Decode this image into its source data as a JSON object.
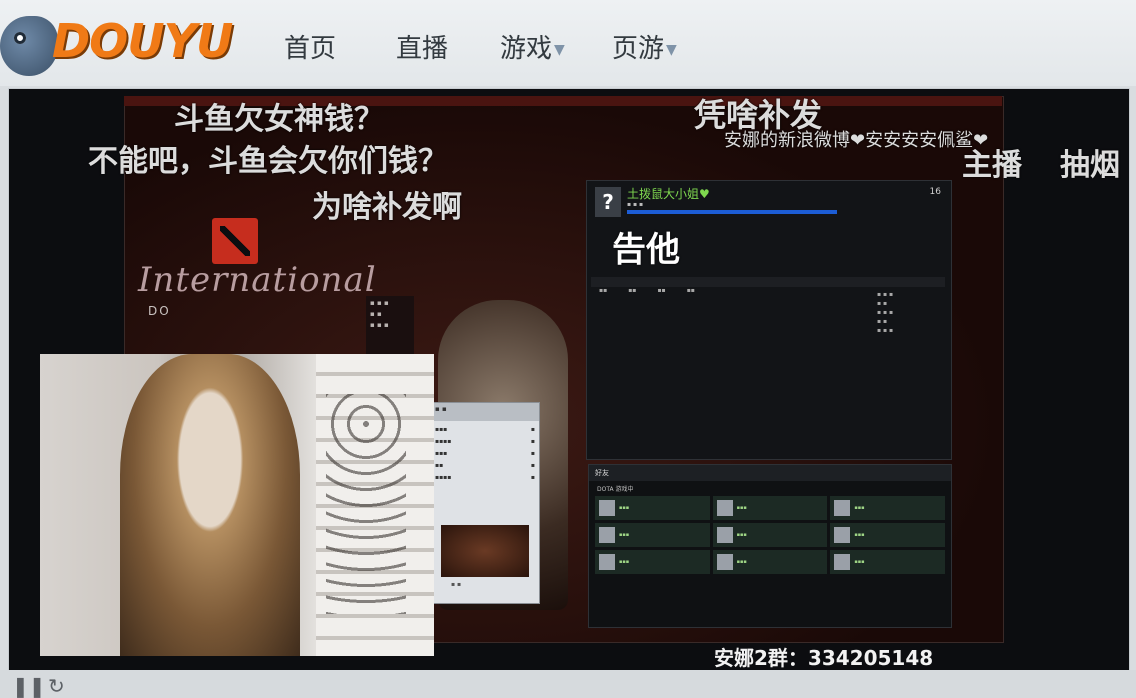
{
  "brand": {
    "logo_text": "DOUYU"
  },
  "nav": [
    {
      "label": "首页",
      "dropdown": false
    },
    {
      "label": "直播",
      "dropdown": false
    },
    {
      "label": "游戏",
      "dropdown": true
    },
    {
      "label": "页游",
      "dropdown": true
    }
  ],
  "danmaku": [
    "斗鱼欠女神钱？",
    "不能吧，斗鱼会欠你们钱？",
    "为啥补发啊",
    "凭啥补发",
    "安娜的新浪微博❤安安安安佩鲨❤",
    "主播",
    "抽烟",
    "告他"
  ],
  "game": {
    "intl_text": "International",
    "dota_small": "DO",
    "client_user": "土拨鼠大小姐♥",
    "friend_count": "16",
    "friends_title": "好友",
    "friends_sub": "DOTA 游戏中"
  },
  "caption": "安娜2群：334205148",
  "controls": {
    "pause_icon": "pause-icon",
    "refresh_icon": "refresh-icon"
  }
}
